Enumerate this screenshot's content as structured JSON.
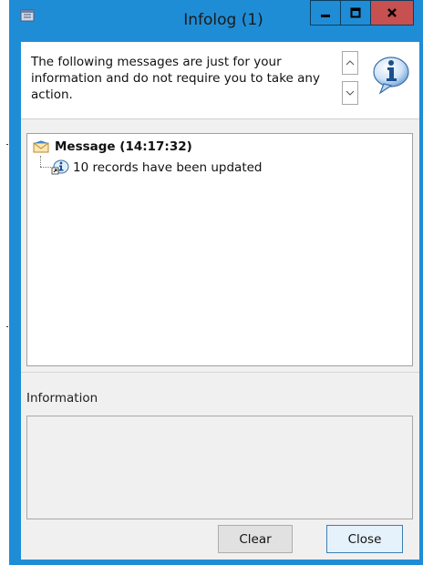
{
  "window": {
    "title": "Infolog (1)",
    "accent_color": "#1f8dd6",
    "close_color": "#c75050"
  },
  "header": {
    "message": "The following messages are just for your information and do not require you to take any action.",
    "icon": "info-icon"
  },
  "tree": {
    "message_node": {
      "label": "Message (14:17:32)",
      "icon": "envelope-icon"
    },
    "children": [
      {
        "label": "10 records have been updated",
        "icon": "info-icon"
      }
    ]
  },
  "details": {
    "label": "Information",
    "content": ""
  },
  "buttons": {
    "clear": "Clear",
    "close": "Close"
  },
  "title_buttons": [
    "minimize-icon",
    "maximize-icon",
    "close-icon"
  ]
}
